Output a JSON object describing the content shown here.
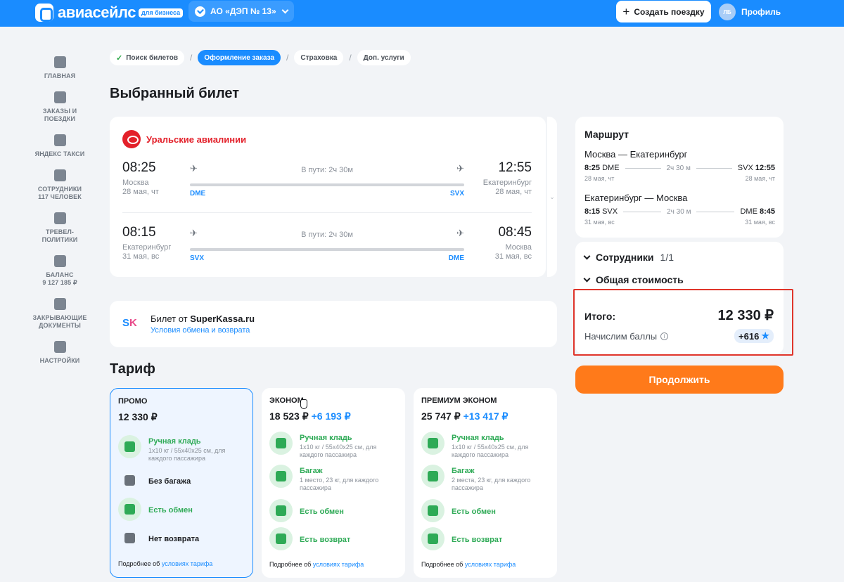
{
  "header": {
    "logo_text": "авиасейлс",
    "logo_badge": "для бизнеса",
    "company": "АО «ДЭП № 13»",
    "create_trip": "Создать поездку",
    "profile_initials": "ЛБ",
    "profile_label": "Профиль",
    "accent": "#1a8cff"
  },
  "sidebar": [
    {
      "label": "ГЛАВНАЯ",
      "icon": "grid-icon"
    },
    {
      "label": "ЗАКАЗЫ И ПОЕЗДКИ",
      "icon": "plane-icon"
    },
    {
      "label": "ЯНДЕКС ТАКСИ",
      "icon": "taxi-icon"
    },
    {
      "label": "СОТРУДНИКИ",
      "sub": "117 ЧЕЛОВЕК",
      "icon": "people-icon"
    },
    {
      "label": "ТРЕВЕЛ- ПОЛИТИКИ",
      "icon": "briefcase-icon"
    },
    {
      "label": "БАЛАНС",
      "sub": "9 127 185 ₽",
      "icon": "wallet-icon"
    },
    {
      "label": "ЗАКРЫВАЮЩИЕ ДОКУМЕНТЫ",
      "icon": "document-icon"
    },
    {
      "label": "НАСТРОЙКИ",
      "icon": "gear-icon"
    }
  ],
  "breadcrumbs": [
    "Поиск билетов",
    "Оформление заказа",
    "Страховка",
    "Доп. услуги"
  ],
  "page_title": "Выбранный билет",
  "ticket": {
    "airline": "Уральские авиалинии",
    "legs": [
      {
        "dep_time": "08:25",
        "dep_city": "Москва",
        "dep_date": "28 мая, чт",
        "duration": "В пути: 2ч 30м",
        "dep_code": "DME",
        "arr_code": "SVX",
        "arr_time": "12:55",
        "arr_city": "Екатеринбург",
        "arr_date": "28 мая, чт"
      },
      {
        "dep_time": "08:15",
        "dep_city": "Екатеринбург",
        "dep_date": "31 мая, вс",
        "duration": "В пути: 2ч 30м",
        "dep_code": "SVX",
        "arr_code": "DME",
        "arr_time": "08:45",
        "arr_city": "Москва",
        "arr_date": "31 мая, вс"
      }
    ]
  },
  "seller": {
    "prefix": "Билет от",
    "name": "SuperKassa.ru",
    "link": "Условия обмена и возврата"
  },
  "tariff_title": "Тариф",
  "tariffs": [
    {
      "name": "ПРОМО",
      "price": "12 330 ₽",
      "add": "",
      "features": [
        {
          "title": "Ручная кладь",
          "desc": "1x10 кг / 55x40x25 см, для каждого пассажира",
          "ok": true
        },
        {
          "title": "Без багажа",
          "desc": "",
          "ok": false
        },
        {
          "title": "Есть обмен",
          "desc": "",
          "ok": true
        },
        {
          "title": "Нет возврата",
          "desc": "",
          "ok": false
        }
      ],
      "more_prefix": "Подробнее об",
      "more_link": "условиях тарифа"
    },
    {
      "name": "ЭКОНОМ",
      "price": "18 523 ₽",
      "add": "+6 193 ₽",
      "features": [
        {
          "title": "Ручная кладь",
          "desc": "1x10 кг / 55x40x25 см, для каждого пассажира",
          "ok": true
        },
        {
          "title": "Багаж",
          "desc": "1 место, 23 кг, для каждого пассажира",
          "ok": true
        },
        {
          "title": "Есть обмен",
          "desc": "",
          "ok": true
        },
        {
          "title": "Есть возврат",
          "desc": "",
          "ok": true
        }
      ],
      "more_prefix": "Подробнее об",
      "more_link": "условиях тарифа"
    },
    {
      "name": "ПРЕМИУМ ЭКОНОМ",
      "price": "25 747 ₽",
      "add": "+13 417 ₽",
      "features": [
        {
          "title": "Ручная кладь",
          "desc": "1x10 кг / 55x40x25 см, для каждого пассажира",
          "ok": true
        },
        {
          "title": "Багаж",
          "desc": "2 места, 23 кг, для каждого пассажира",
          "ok": true
        },
        {
          "title": "Есть обмен",
          "desc": "",
          "ok": true
        },
        {
          "title": "Есть возврат",
          "desc": "",
          "ok": true
        }
      ],
      "more_prefix": "Подробнее об",
      "more_link": "условиях тарифа"
    }
  ],
  "route": {
    "title": "Маршрут",
    "legs": [
      {
        "title": "Москва — Екатеринбург",
        "dep_time": "8:25",
        "dep_code": "DME",
        "duration": "2ч 30 м",
        "arr_code": "SVX",
        "arr_time": "12:55",
        "dep_date": "28 мая, чт",
        "arr_date": "28 мая, чт"
      },
      {
        "title": "Екатеринбург — Москва",
        "dep_time": "8:15",
        "dep_code": "SVX",
        "duration": "2ч 30 м",
        "arr_code": "DME",
        "arr_time": "8:45",
        "dep_date": "31 мая, вс",
        "arr_date": "31 мая, вс"
      }
    ]
  },
  "summary": {
    "employees_label": "Сотрудники",
    "employees_count": "1/1",
    "total_cost_label": "Общая стоимость",
    "total_label": "Итого:",
    "total_value": "12 330 ₽",
    "points_label": "Начислим баллы",
    "points_value": "+616",
    "continue": "Продолжить",
    "continue_color": "#ff7a1a"
  }
}
